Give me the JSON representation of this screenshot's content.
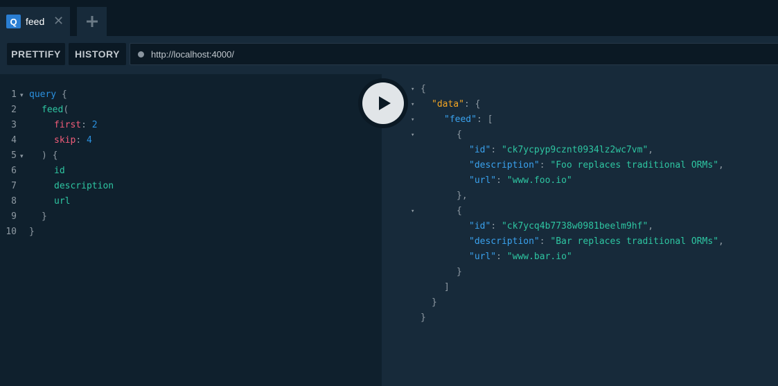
{
  "tabs": {
    "active": {
      "icon_letter": "Q",
      "label": "feed",
      "close": "✕"
    },
    "add": "+"
  },
  "toolbar": {
    "prettify_label": "PRETTIFY",
    "history_label": "HISTORY",
    "endpoint": "http://localhost:4000/"
  },
  "query_editor": {
    "line_numbers": [
      "1",
      "2",
      "3",
      "4",
      "5",
      "6",
      "7",
      "8",
      "9",
      "10"
    ],
    "lines": [
      {
        "tokens": [
          [
            "kw",
            "query"
          ],
          [
            "punc",
            " {"
          ]
        ]
      },
      {
        "tokens": [
          [
            "fn",
            "feed"
          ],
          [
            "punc",
            "("
          ]
        ]
      },
      {
        "tokens": [
          [
            "arg",
            "first"
          ],
          [
            "punc",
            ": "
          ],
          [
            "num",
            "2"
          ]
        ]
      },
      {
        "tokens": [
          [
            "arg",
            "skip"
          ],
          [
            "punc",
            ": "
          ],
          [
            "num",
            "4"
          ]
        ]
      },
      {
        "tokens": [
          [
            "punc",
            ") {"
          ]
        ]
      },
      {
        "tokens": [
          [
            "fn",
            "id"
          ]
        ]
      },
      {
        "tokens": [
          [
            "fn",
            "description"
          ]
        ]
      },
      {
        "tokens": [
          [
            "fn",
            "url"
          ]
        ]
      },
      {
        "tokens": [
          [
            "punc",
            "}"
          ]
        ]
      },
      {
        "tokens": [
          [
            "punc",
            "}"
          ]
        ]
      }
    ]
  },
  "result": {
    "lines": [
      {
        "tokens": [
          [
            "punc",
            "{"
          ]
        ]
      },
      {
        "tokens": [
          [
            "key-data",
            "\"data\""
          ],
          [
            "punc",
            ": {"
          ]
        ]
      },
      {
        "tokens": [
          [
            "key",
            "\"feed\""
          ],
          [
            "punc",
            ": ["
          ]
        ]
      },
      {
        "tokens": [
          [
            "punc",
            "{"
          ]
        ]
      },
      {
        "tokens": [
          [
            "key",
            "\"id\""
          ],
          [
            "punc",
            ": "
          ],
          [
            "str",
            "\"ck7ycpyp9cznt0934lz2wc7vm\""
          ],
          [
            "punc",
            ","
          ]
        ]
      },
      {
        "tokens": [
          [
            "key",
            "\"description\""
          ],
          [
            "punc",
            ": "
          ],
          [
            "str",
            "\"Foo replaces traditional ORMs\""
          ],
          [
            "punc",
            ","
          ]
        ]
      },
      {
        "tokens": [
          [
            "key",
            "\"url\""
          ],
          [
            "punc",
            ": "
          ],
          [
            "str",
            "\"www.foo.io\""
          ]
        ]
      },
      {
        "tokens": [
          [
            "punc",
            "},"
          ]
        ]
      },
      {
        "tokens": [
          [
            "punc",
            "{"
          ]
        ]
      },
      {
        "tokens": [
          [
            "key",
            "\"id\""
          ],
          [
            "punc",
            ": "
          ],
          [
            "str",
            "\"ck7ycq4b7738w0981beelm9hf\""
          ],
          [
            "punc",
            ","
          ]
        ]
      },
      {
        "tokens": [
          [
            "key",
            "\"description\""
          ],
          [
            "punc",
            ": "
          ],
          [
            "str",
            "\"Bar replaces traditional ORMs\""
          ],
          [
            "punc",
            ","
          ]
        ]
      },
      {
        "tokens": [
          [
            "key",
            "\"url\""
          ],
          [
            "punc",
            ": "
          ],
          [
            "str",
            "\"www.bar.io\""
          ]
        ]
      },
      {
        "tokens": [
          [
            "punc",
            "}"
          ]
        ]
      },
      {
        "tokens": [
          [
            "punc",
            "]"
          ]
        ]
      },
      {
        "tokens": [
          [
            "punc",
            "}"
          ]
        ]
      },
      {
        "tokens": [
          [
            "punc",
            "}"
          ]
        ]
      }
    ]
  },
  "icons": {
    "play": "play-icon",
    "fold": "▾"
  },
  "colors": {
    "keyword": "#2b91e0",
    "field": "#2ec6a2",
    "argument": "#f25c79",
    "data_key": "#f5a623",
    "json_key": "#3aa2ee",
    "string": "#2ec6a2"
  }
}
